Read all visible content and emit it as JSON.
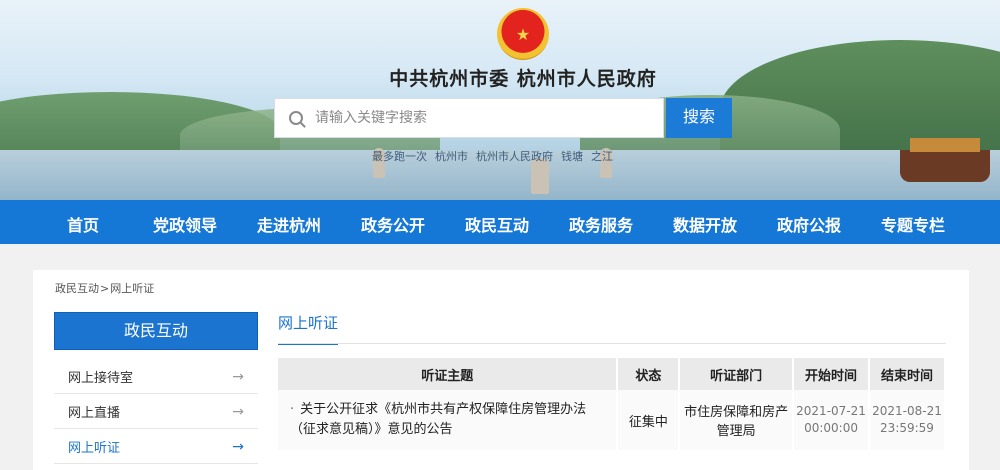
{
  "header": {
    "emblem_glyph": "★",
    "site_title": "中共杭州市委  杭州市人民政府",
    "search": {
      "placeholder": "请输入关键字搜索",
      "button_label": "搜索"
    },
    "hotwords": [
      "最多跑一次",
      "杭州市",
      "杭州市人民政府",
      "钱塘",
      "之江"
    ]
  },
  "nav": {
    "items": [
      "首页",
      "党政领导",
      "走进杭州",
      "政务公开",
      "政民互动",
      "政务服务",
      "数据开放",
      "政府公报",
      "专题专栏"
    ]
  },
  "breadcrumb": {
    "parent": "政民互动",
    "separator": ">",
    "current": "网上听证"
  },
  "sidebar": {
    "title": "政民互动",
    "arrow_glyph": "→",
    "items": [
      "网上接待室",
      "网上直播",
      "网上听证"
    ],
    "active_index": 2
  },
  "main": {
    "title": "网上听证",
    "table": {
      "columns": [
        "听证主题",
        "状态",
        "听证部门",
        "开始时间",
        "结束时间"
      ],
      "rows": [
        {
          "topic": "关于公开征求《杭州市共有产权保障住房管理办法（征求意见稿）》意见的公告",
          "status": "征集中",
          "department": "市住房保障和房产管理局",
          "start_date": "2021-07-21",
          "start_time": "00:00:00",
          "end_date": "2021-08-21",
          "end_time": "23:59:59"
        }
      ]
    }
  },
  "colors": {
    "primary": "#1577d6",
    "sidebar_head": "#1b74cf"
  }
}
